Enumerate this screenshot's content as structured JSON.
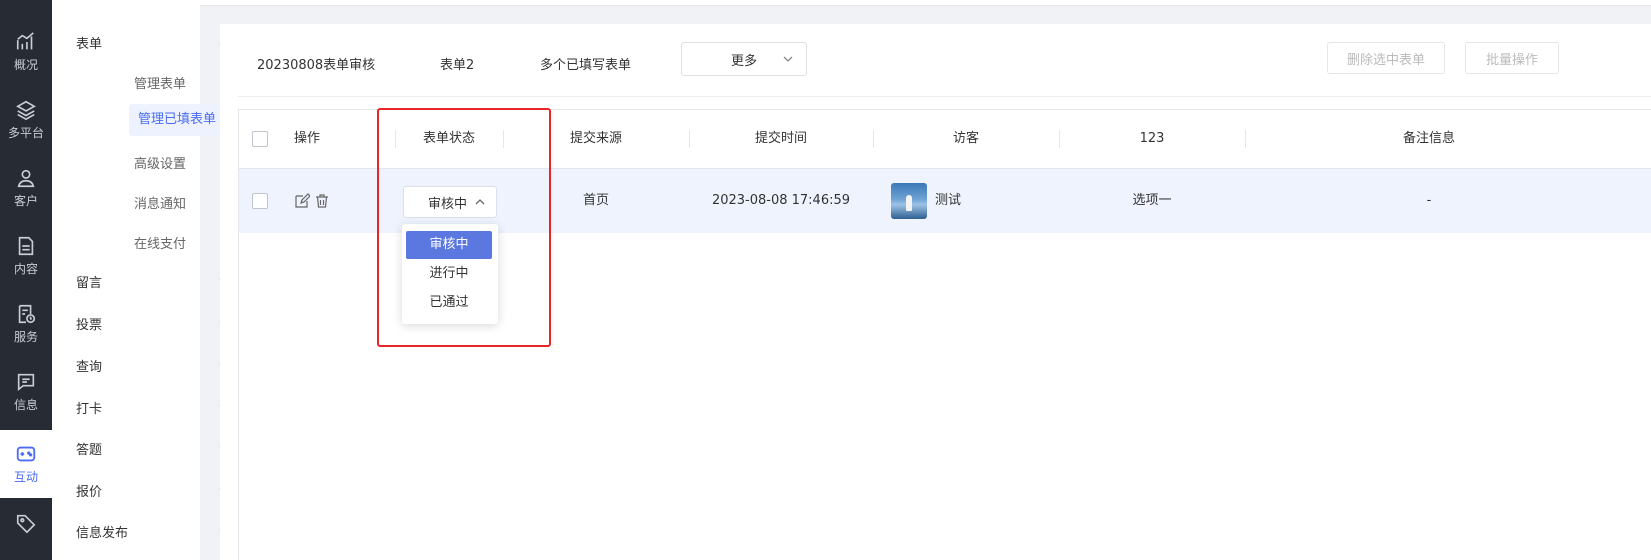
{
  "rail": {
    "items": [
      {
        "label": "概况",
        "icon": "chart-trend-icon"
      },
      {
        "label": "多平台",
        "icon": "layers-icon"
      },
      {
        "label": "客户",
        "icon": "user-icon"
      },
      {
        "label": "内容",
        "icon": "document-icon"
      },
      {
        "label": "服务",
        "icon": "service-icon"
      },
      {
        "label": "信息",
        "icon": "message-icon"
      },
      {
        "label": "互动",
        "icon": "gamepad-icon",
        "active": true
      },
      {
        "label": "",
        "icon": "tag-icon"
      }
    ]
  },
  "subnav": {
    "groups": [
      {
        "label": "表单",
        "expanded": true
      },
      {
        "label": "留言"
      },
      {
        "label": "投票"
      },
      {
        "label": "查询"
      },
      {
        "label": "打卡"
      },
      {
        "label": "答题"
      },
      {
        "label": "报价"
      },
      {
        "label": "信息发布"
      }
    ],
    "subitems": [
      "管理表单",
      "管理已填表单",
      "高级设置",
      "消息通知",
      "在线支付"
    ],
    "active_subitem": "管理已填表单"
  },
  "tabs": [
    "20230808表单审核",
    "表单2",
    "多个已填写表单"
  ],
  "more_select": {
    "label": "更多"
  },
  "buttons": {
    "delete_selected": "删除选中表单",
    "batch": "批量操作"
  },
  "table": {
    "headers": {
      "operate": "操作",
      "status": "表单状态",
      "source": "提交来源",
      "time": "提交时间",
      "visitor": "访客",
      "field_123": "123",
      "remark": "备注信息"
    },
    "rows": [
      {
        "status": "审核中",
        "source": "首页",
        "time": "2023-08-08 17:46:59",
        "visitor": "测试",
        "field_123": "选项一",
        "remark": "-"
      }
    ]
  },
  "status_dropdown": {
    "options": [
      "审核中",
      "进行中",
      "已通过"
    ],
    "selected": "审核中"
  },
  "colors": {
    "accent": "#4a6cf7",
    "highlight": "#e8262a",
    "rail_bg": "#272b33",
    "row_selected": "#eef3fd"
  }
}
